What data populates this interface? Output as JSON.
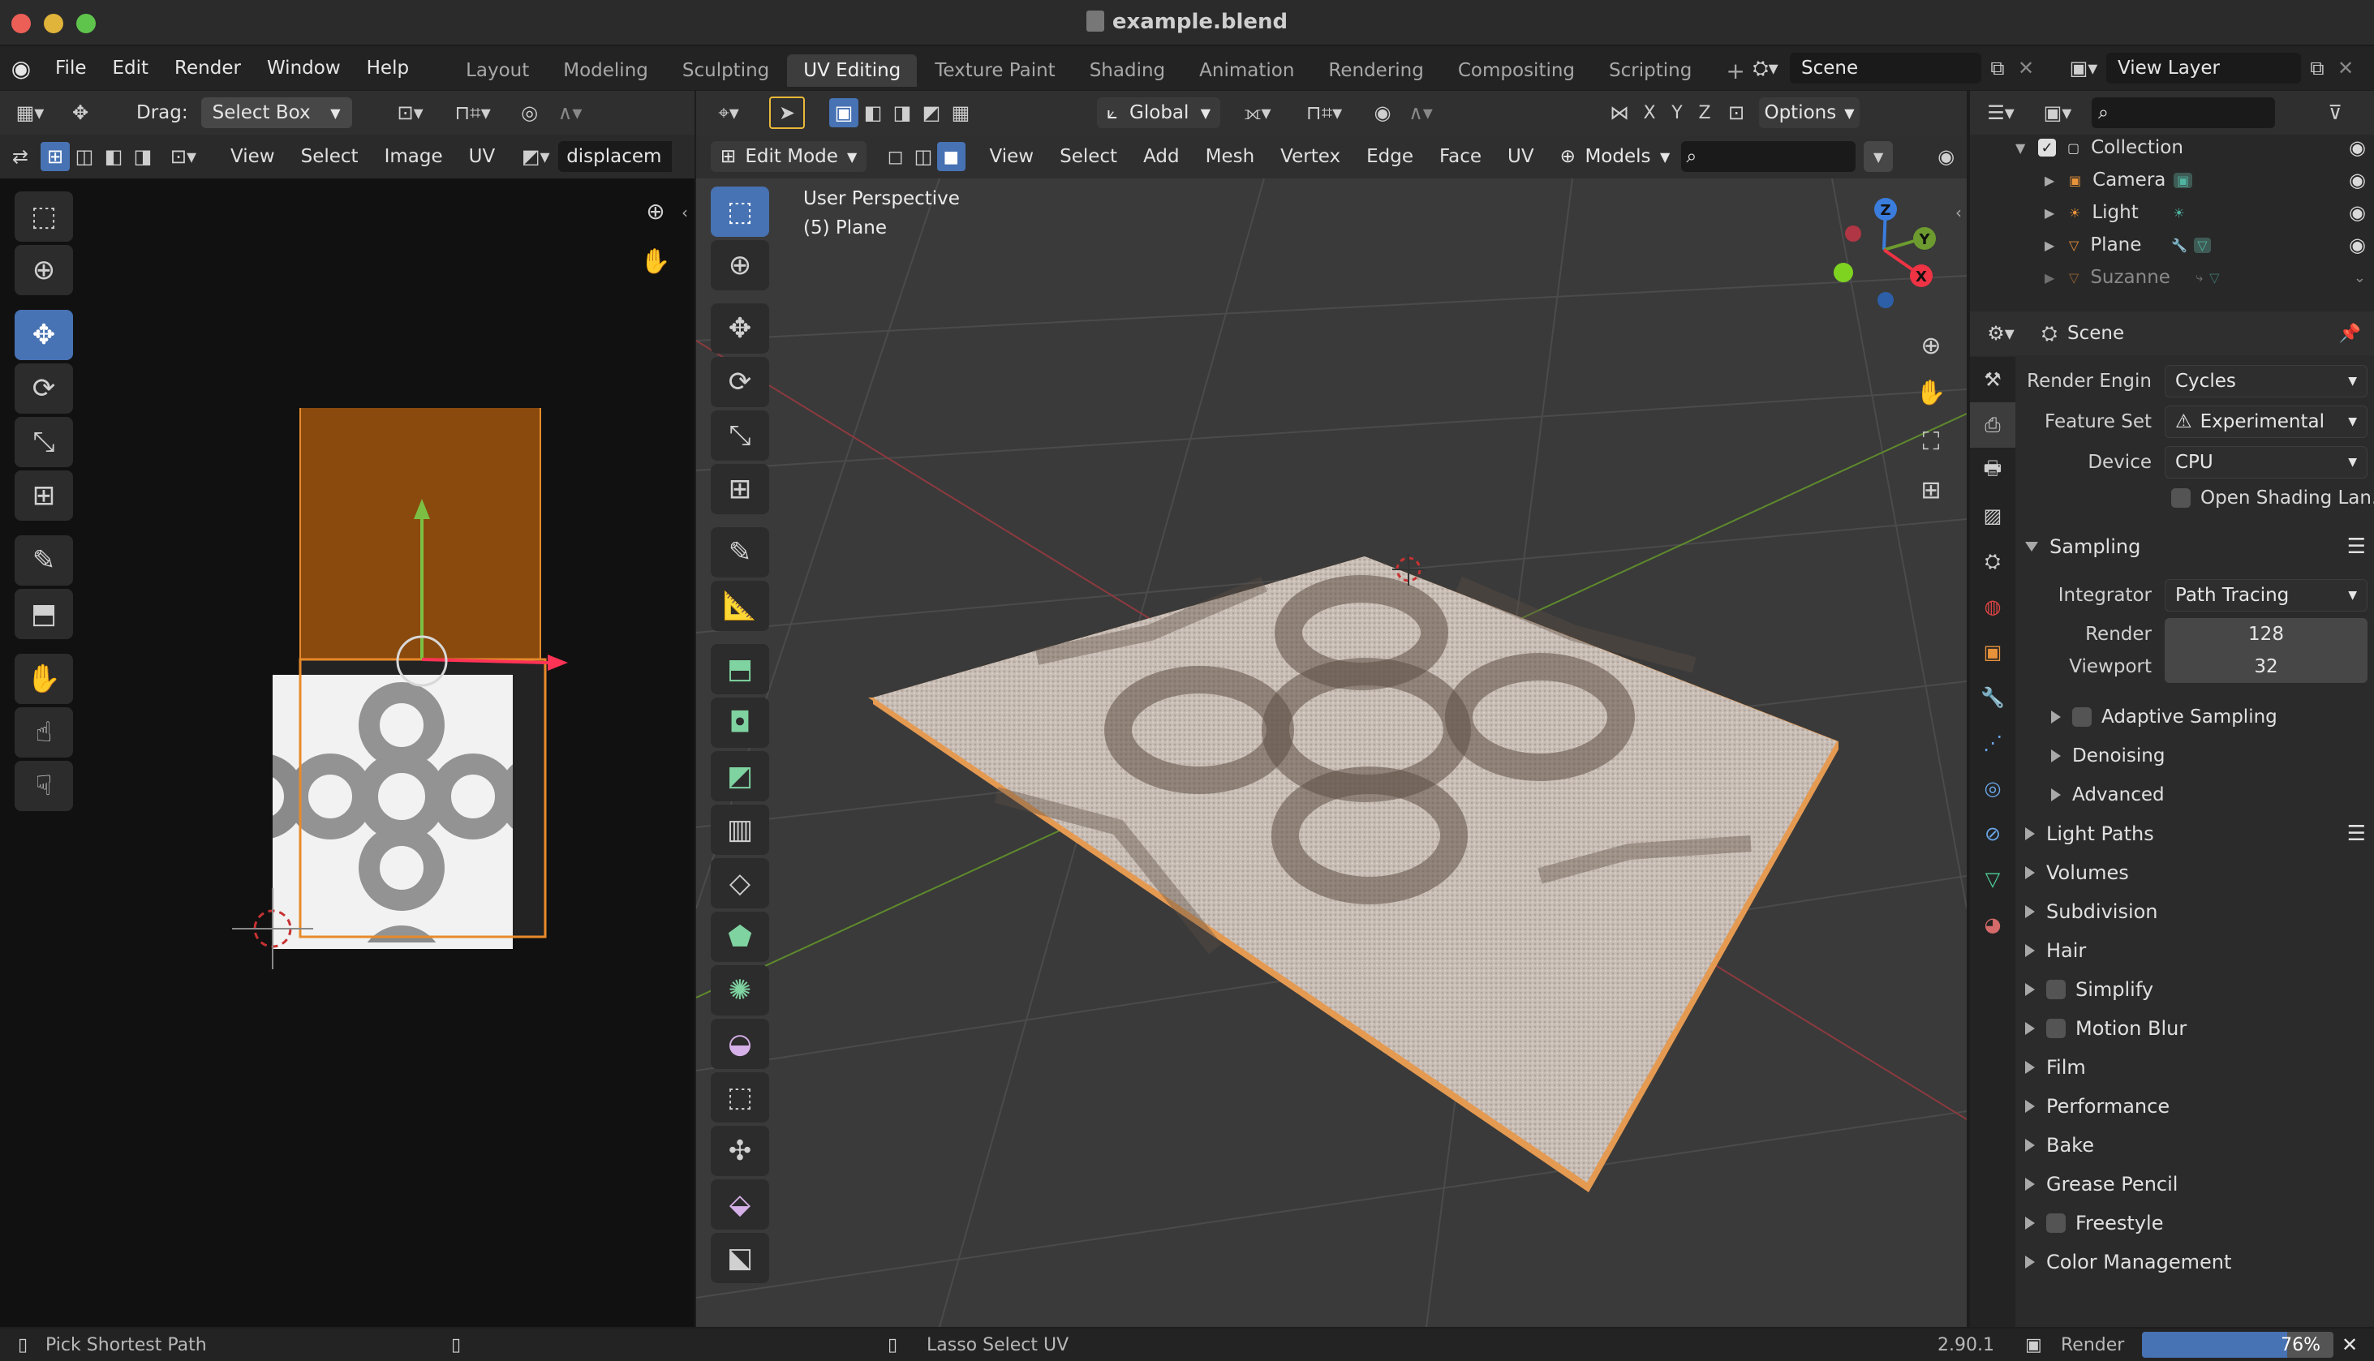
{
  "window": {
    "title": "example.blend"
  },
  "menu": {
    "items": [
      "File",
      "Edit",
      "Render",
      "Window",
      "Help"
    ]
  },
  "workspaces": {
    "tabs": [
      "Layout",
      "Modeling",
      "Sculpting",
      "UV Editing",
      "Texture Paint",
      "Shading",
      "Animation",
      "Rendering",
      "Compositing",
      "Scripting"
    ],
    "active": "UV Editing",
    "add": "+"
  },
  "scene": {
    "name": "Scene",
    "view_layer": "View Layer"
  },
  "uv_editor": {
    "drag_label": "Drag:",
    "drag_value": "Select Box",
    "menus": [
      "View",
      "Select",
      "Image",
      "UV"
    ],
    "image_name": "displacem"
  },
  "viewport": {
    "orientation": "Global",
    "options_label": "Options",
    "mode": "Edit Mode",
    "menus": [
      "View",
      "Select",
      "Add",
      "Mesh",
      "Vertex",
      "Edge",
      "Face",
      "UV"
    ],
    "models_label": "Models",
    "axis_labels": [
      "X",
      "Y",
      "Z"
    ],
    "overlay_title": "User Perspective",
    "overlay_object": "(5) Plane",
    "gizmo": {
      "z": "Z",
      "y": "Y",
      "x": "X"
    }
  },
  "outliner": {
    "items": [
      {
        "name": "Collection"
      },
      {
        "name": "Camera"
      },
      {
        "name": "Light"
      },
      {
        "name": "Plane"
      },
      {
        "name": "Suzanne"
      }
    ]
  },
  "properties": {
    "context": "Scene",
    "render_engine_label": "Render Engin",
    "render_engine_value": "Cycles",
    "feature_set_label": "Feature Set",
    "feature_set_value": "Experimental",
    "device_label": "Device",
    "device_value": "CPU",
    "open_shading_label": "Open Shading Lan...",
    "sampling_label": "Sampling",
    "integrator_label": "Integrator",
    "integrator_value": "Path Tracing",
    "render_label": "Render",
    "render_value": "128",
    "viewport_label": "Viewport",
    "viewport_value": "32",
    "sub_panels": [
      "Adaptive Sampling",
      "Denoising",
      "Advanced"
    ],
    "panels": [
      "Light Paths",
      "Volumes",
      "Subdivision",
      "Hair",
      "Simplify",
      "Motion Blur",
      "Film",
      "Performance",
      "Bake",
      "Grease Pencil",
      "Freestyle",
      "Color Management"
    ]
  },
  "status": {
    "left": "Pick Shortest Path",
    "middle": "Lasso Select UV",
    "version": "2.90.1",
    "job_label": "Render",
    "progress_text": "76%",
    "progress": 0.76
  },
  "colors": {
    "accent": "#4772b3",
    "selection_orange": "#e88a2a",
    "uv_fill": "#8a4a0e"
  }
}
